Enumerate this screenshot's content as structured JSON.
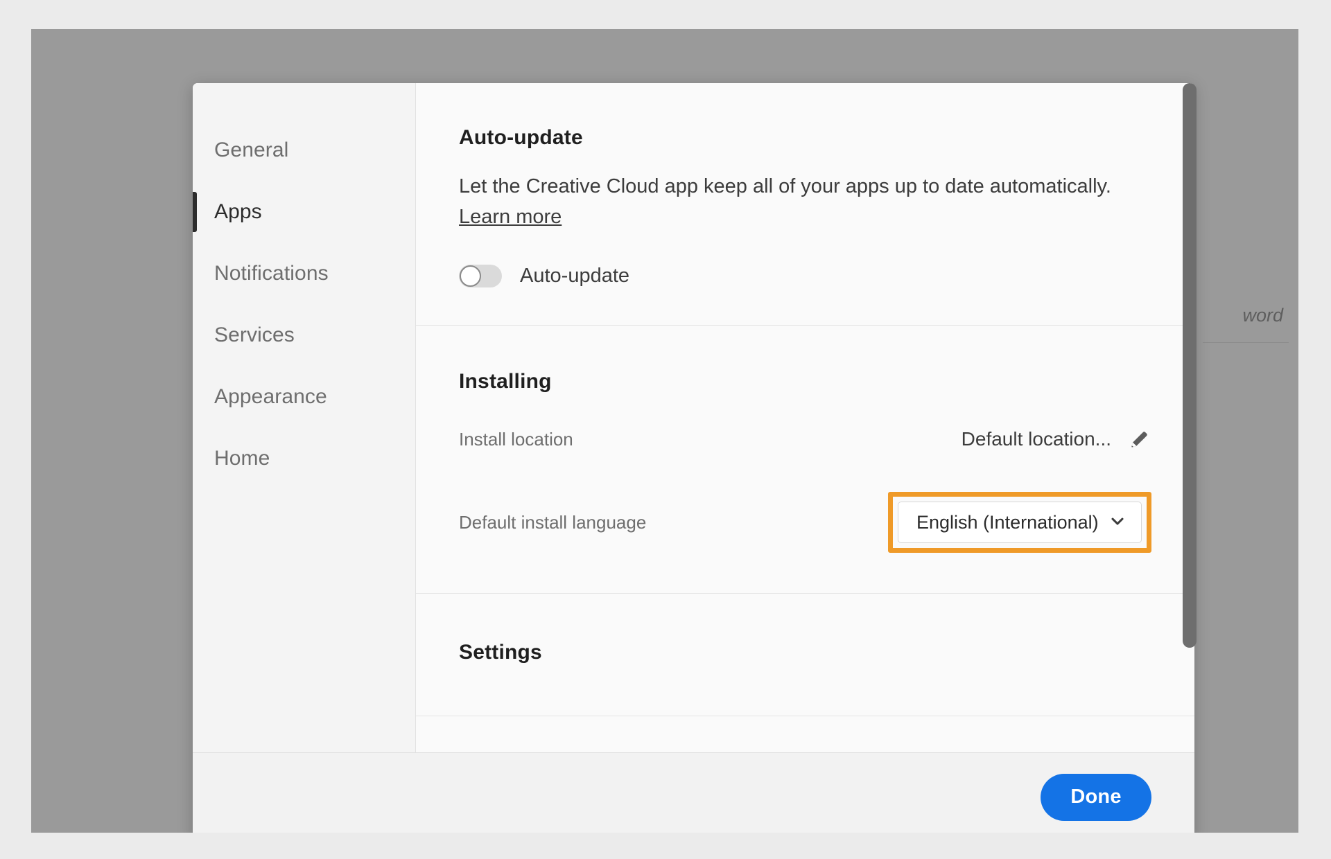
{
  "background": {
    "peek_text": "word",
    "overlay_color": "#9a9a9a",
    "page_color": "#ebebeb"
  },
  "dialog": {
    "sidebar": {
      "items": [
        {
          "label": "General",
          "active": false
        },
        {
          "label": "Apps",
          "active": true
        },
        {
          "label": "Notifications",
          "active": false
        },
        {
          "label": "Services",
          "active": false
        },
        {
          "label": "Appearance",
          "active": false
        },
        {
          "label": "Home",
          "active": false
        }
      ]
    },
    "sections": {
      "auto_update": {
        "title": "Auto-update",
        "description": "Let the Creative Cloud app keep all of your apps up to date automatically.",
        "learn_more": "Learn more",
        "toggle_label": "Auto-update",
        "toggle_state": "off"
      },
      "installing": {
        "title": "Installing",
        "install_location_label": "Install location",
        "install_location_value": "Default location...",
        "edit_icon": "pencil-icon",
        "default_language_label": "Default install language",
        "default_language_value": "English (International)",
        "dropdown_icon": "chevron-down-icon",
        "highlight_color": "#ef9a28"
      },
      "settings": {
        "title": "Settings"
      }
    },
    "footer": {
      "done_label": "Done",
      "done_color": "#1473e6"
    },
    "scrollbar": {
      "icon": "vertical-scrollbar-thumb"
    }
  }
}
